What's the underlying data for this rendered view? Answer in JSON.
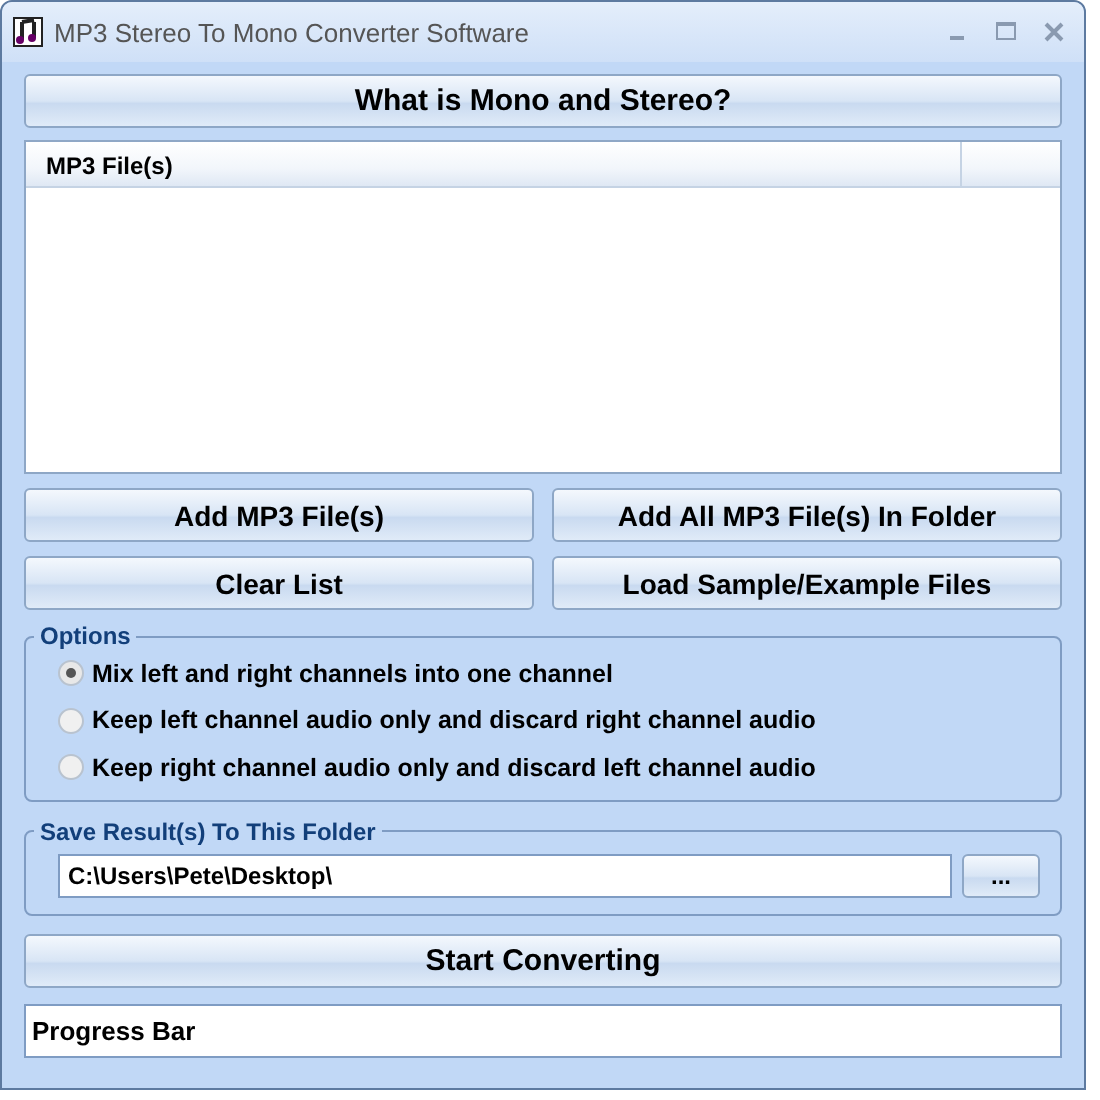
{
  "window": {
    "title": "MP3 Stereo To Mono Converter Software"
  },
  "help_button": "What is Mono and Stereo?",
  "file_list": {
    "columns": [
      "MP3 File(s)"
    ]
  },
  "buttons": [
    "Add MP3 File(s)",
    "Add All MP3 File(s) In Folder",
    "Clear List",
    "Load Sample/Example Files"
  ],
  "options": {
    "title": "Options",
    "choices": [
      {
        "label": "Mix left and right channels into one channel",
        "selected": true
      },
      {
        "label": "Keep left channel audio only and discard right channel audio",
        "selected": false
      },
      {
        "label": "Keep right channel audio only and discard left channel audio",
        "selected": false
      }
    ]
  },
  "save_folder": {
    "title": "Save Result(s) To This Folder",
    "value": "C:\\Users\\Pete\\Desktop\\",
    "browse": "..."
  },
  "start_button": "Start Converting",
  "progress": {
    "label": "Progress Bar"
  }
}
